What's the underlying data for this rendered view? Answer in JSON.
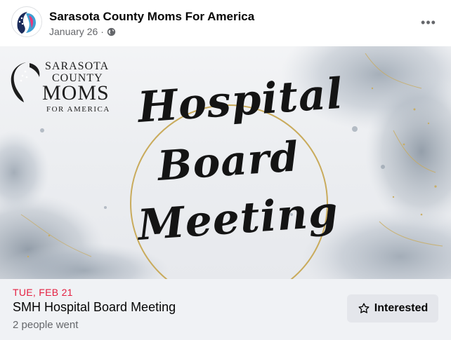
{
  "post": {
    "author": "Sarasota County Moms For America",
    "date": "January 26",
    "separator": "·",
    "audience_icon": "globe-icon",
    "menu_icon": "more-horizontal-icon",
    "menu_glyph": "•••"
  },
  "banner": {
    "org_logo_lines": [
      "SARASOTA",
      "COUNTY",
      "MOMS",
      "FOR AMERICA"
    ],
    "title_lines": [
      "Hospital",
      "Board",
      "Meeting"
    ],
    "accent_color": "#c9ab5c"
  },
  "event": {
    "date": "TUE, FEB 21",
    "title": "SMH Hospital Board Meeting",
    "stats": "2 people went",
    "interested_label": "Interested",
    "interested_icon": "star-icon",
    "date_color": "#e41e3f"
  }
}
